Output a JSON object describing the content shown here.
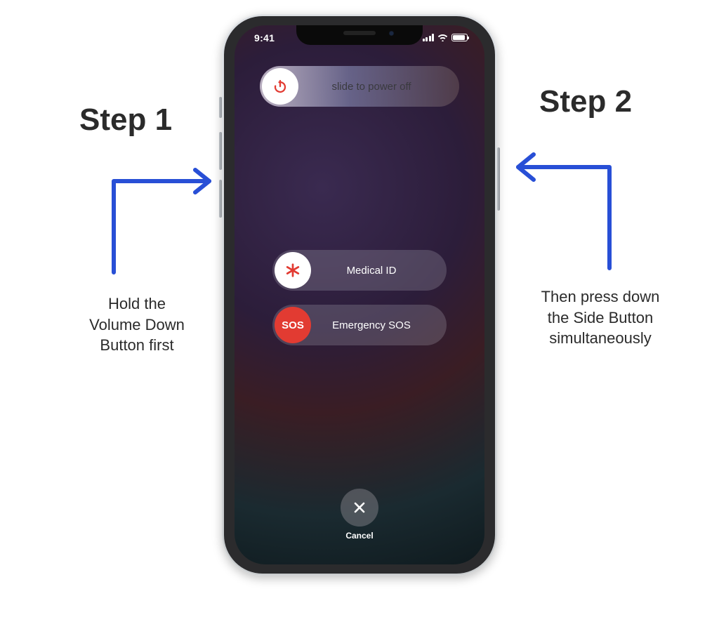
{
  "status": {
    "time": "9:41"
  },
  "sliders": {
    "poweroff": "slide to power off",
    "medical": "Medical ID",
    "sos": "Emergency SOS",
    "sos_knob": "SOS"
  },
  "cancel": "Cancel",
  "steps": {
    "left": {
      "title": "Step 1",
      "body": "Hold the\nVolume Down\nButton first"
    },
    "right": {
      "title": "Step 2",
      "body": "Then press down\nthe Side Button\nsimultaneously"
    }
  }
}
